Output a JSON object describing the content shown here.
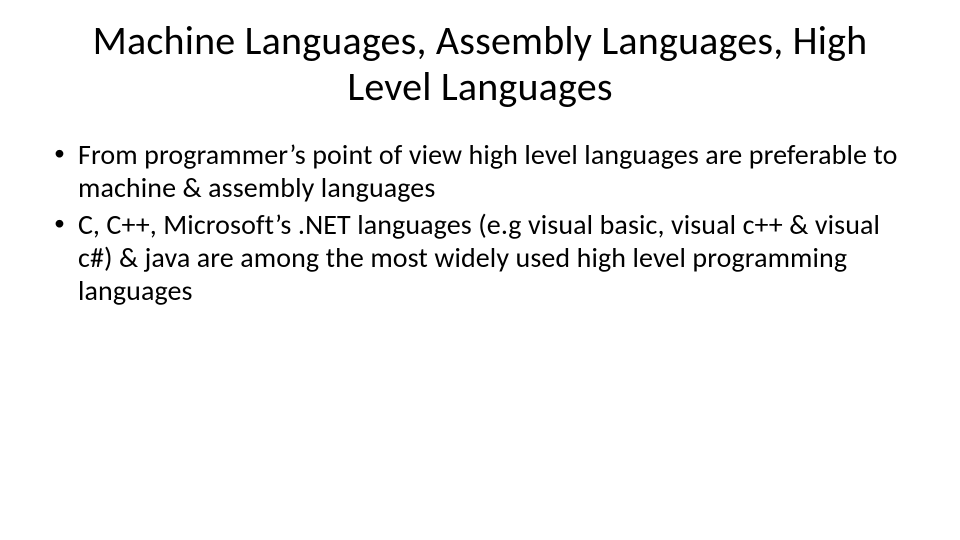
{
  "slide": {
    "title": "Machine Languages, Assembly Languages, High Level Languages",
    "bullets": [
      "From programmer’s point of view high level languages are preferable to machine & assembly languages",
      "C, C++, Microsoft’s .NET languages (e.g visual basic, visual c++ & visual c#) & java are among the most widely used high level programming languages"
    ]
  }
}
